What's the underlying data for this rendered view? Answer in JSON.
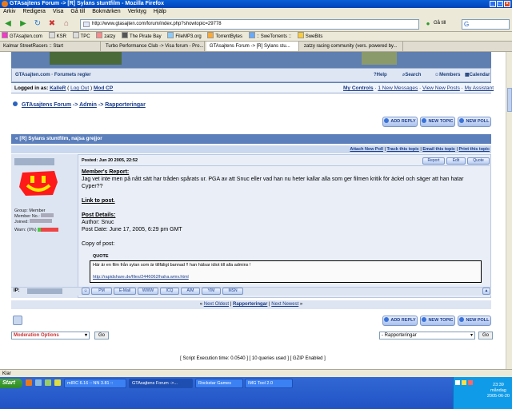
{
  "window": {
    "title": "GTAsajtens Forum -> [R] Sylans stuntfilm - Mozilla Firefox"
  },
  "menu": [
    "Arkiv",
    "Redigera",
    "Visa",
    "Gå till",
    "Bokmärken",
    "Verktyg",
    "Hjälp"
  ],
  "browser": {
    "url": "http://www.gtasajten.com/forum/index.php?showtopic=29778",
    "go_label": "Gå till"
  },
  "bookmarks": [
    "GTAsajten.com",
    "KSR",
    "TPC",
    "zatzy",
    "The Pirate Bay",
    "FileMP3.org",
    "TorrentBytes",
    ":: SweTorrents ::",
    "SweBits"
  ],
  "tabs": [
    {
      "label": "Kalmar StreetRacers :: Start",
      "active": false
    },
    {
      "label": "Turbo Performance Club -> Visa forum - Pro...",
      "active": false
    },
    {
      "label": "GTAsajtens Forum -> [R] Sylans stu...",
      "active": true
    },
    {
      "label": "zatzy racing community (vers. powered by...",
      "active": false
    }
  ],
  "forum_nav": {
    "site": "GTAsajten.com · Forumets regler",
    "help": "Help",
    "search": "Search",
    "members": "Members",
    "calendar": "Calendar"
  },
  "login": {
    "prefix": "Logged in as:",
    "user": "KalleR",
    "logout": "Log Out",
    "modcp": "Mod CP",
    "my_controls": "My Controls",
    "new_messages": "1 New Messages",
    "view_new": "View New Posts",
    "assistant": "My Assistant"
  },
  "breadcrumb": {
    "forum": "GTAsajtens Forum",
    "admin": "Admin",
    "reports": "Rapporteringar",
    "sep": "->"
  },
  "buttons": {
    "add_reply": "ADD REPLY",
    "new_topic": "NEW TOPIC",
    "new_poll": "NEW POLL"
  },
  "topic": {
    "title": "[R] Sylans stuntfilm, najsa grejjor",
    "links": [
      "Attach New Poll",
      "Track this topic",
      "Email this topic",
      "Print this topic"
    ]
  },
  "post": {
    "posted": "Posted: Jun 20 2005, 22:52",
    "btn_report": "Report",
    "btn_edit": "Edit",
    "btn_quote": "Quote",
    "user_info": {
      "group": "Group: Member",
      "member_no": "Member No.:",
      "joined": "Joined:",
      "warn": "Warn: (0%)"
    },
    "report_heading": "Member's Report:",
    "report_text": "Jag vet inte men på nått sätt har tråden spårats ur. PGA av att Snuc eller vad han nu heter kallar alla som ger filmen kritik för äckel och säger att han hatar Cyper??",
    "link_label": "Link to post.",
    "details_heading": "Post Details:",
    "author": "Author: Snuc",
    "post_date": "Post Date: June 17, 2005, 6:29 pm GMT",
    "copy_label": "Copy of post:",
    "quote_label": "QUOTE",
    "quote_text": "Här är en film från sylan som är tillfäligt bannad !! han hälsar idiot till alla admins !",
    "quote_link": "http://rapidshare.de/files/2446062/haha.wmv.html",
    "ip_label": "IP:",
    "contact": [
      "PM",
      "E-Mail",
      "WWW",
      "ICQ",
      "AIM",
      "YIM",
      "MSN"
    ]
  },
  "pagenav": {
    "prev": "Next Oldest",
    "reports": "Rapporteringar",
    "next": "Next Newest"
  },
  "moderation": {
    "label": "Moderation Options",
    "go": "Go"
  },
  "jump": {
    "label": "- Rapporteringar",
    "go": "Go"
  },
  "footer": "[ Script Execution time: 0.0540 ]   [ 10 queries used ]   [ GZIP Enabled ]",
  "status": "Klar",
  "taskbar": {
    "start": "Start",
    "tasks": [
      {
        "label": "mIRC 6.16 :: NN 3.81 ::",
        "active": false
      },
      {
        "label": "GTAsajtens Forum ->...",
        "active": true
      },
      {
        "label": "Rockstar Games",
        "active": false
      },
      {
        "label": "IMG Tool 2.0",
        "active": false
      }
    ],
    "clock": "23:39",
    "day": "måndag",
    "date": "2005-06-20"
  }
}
